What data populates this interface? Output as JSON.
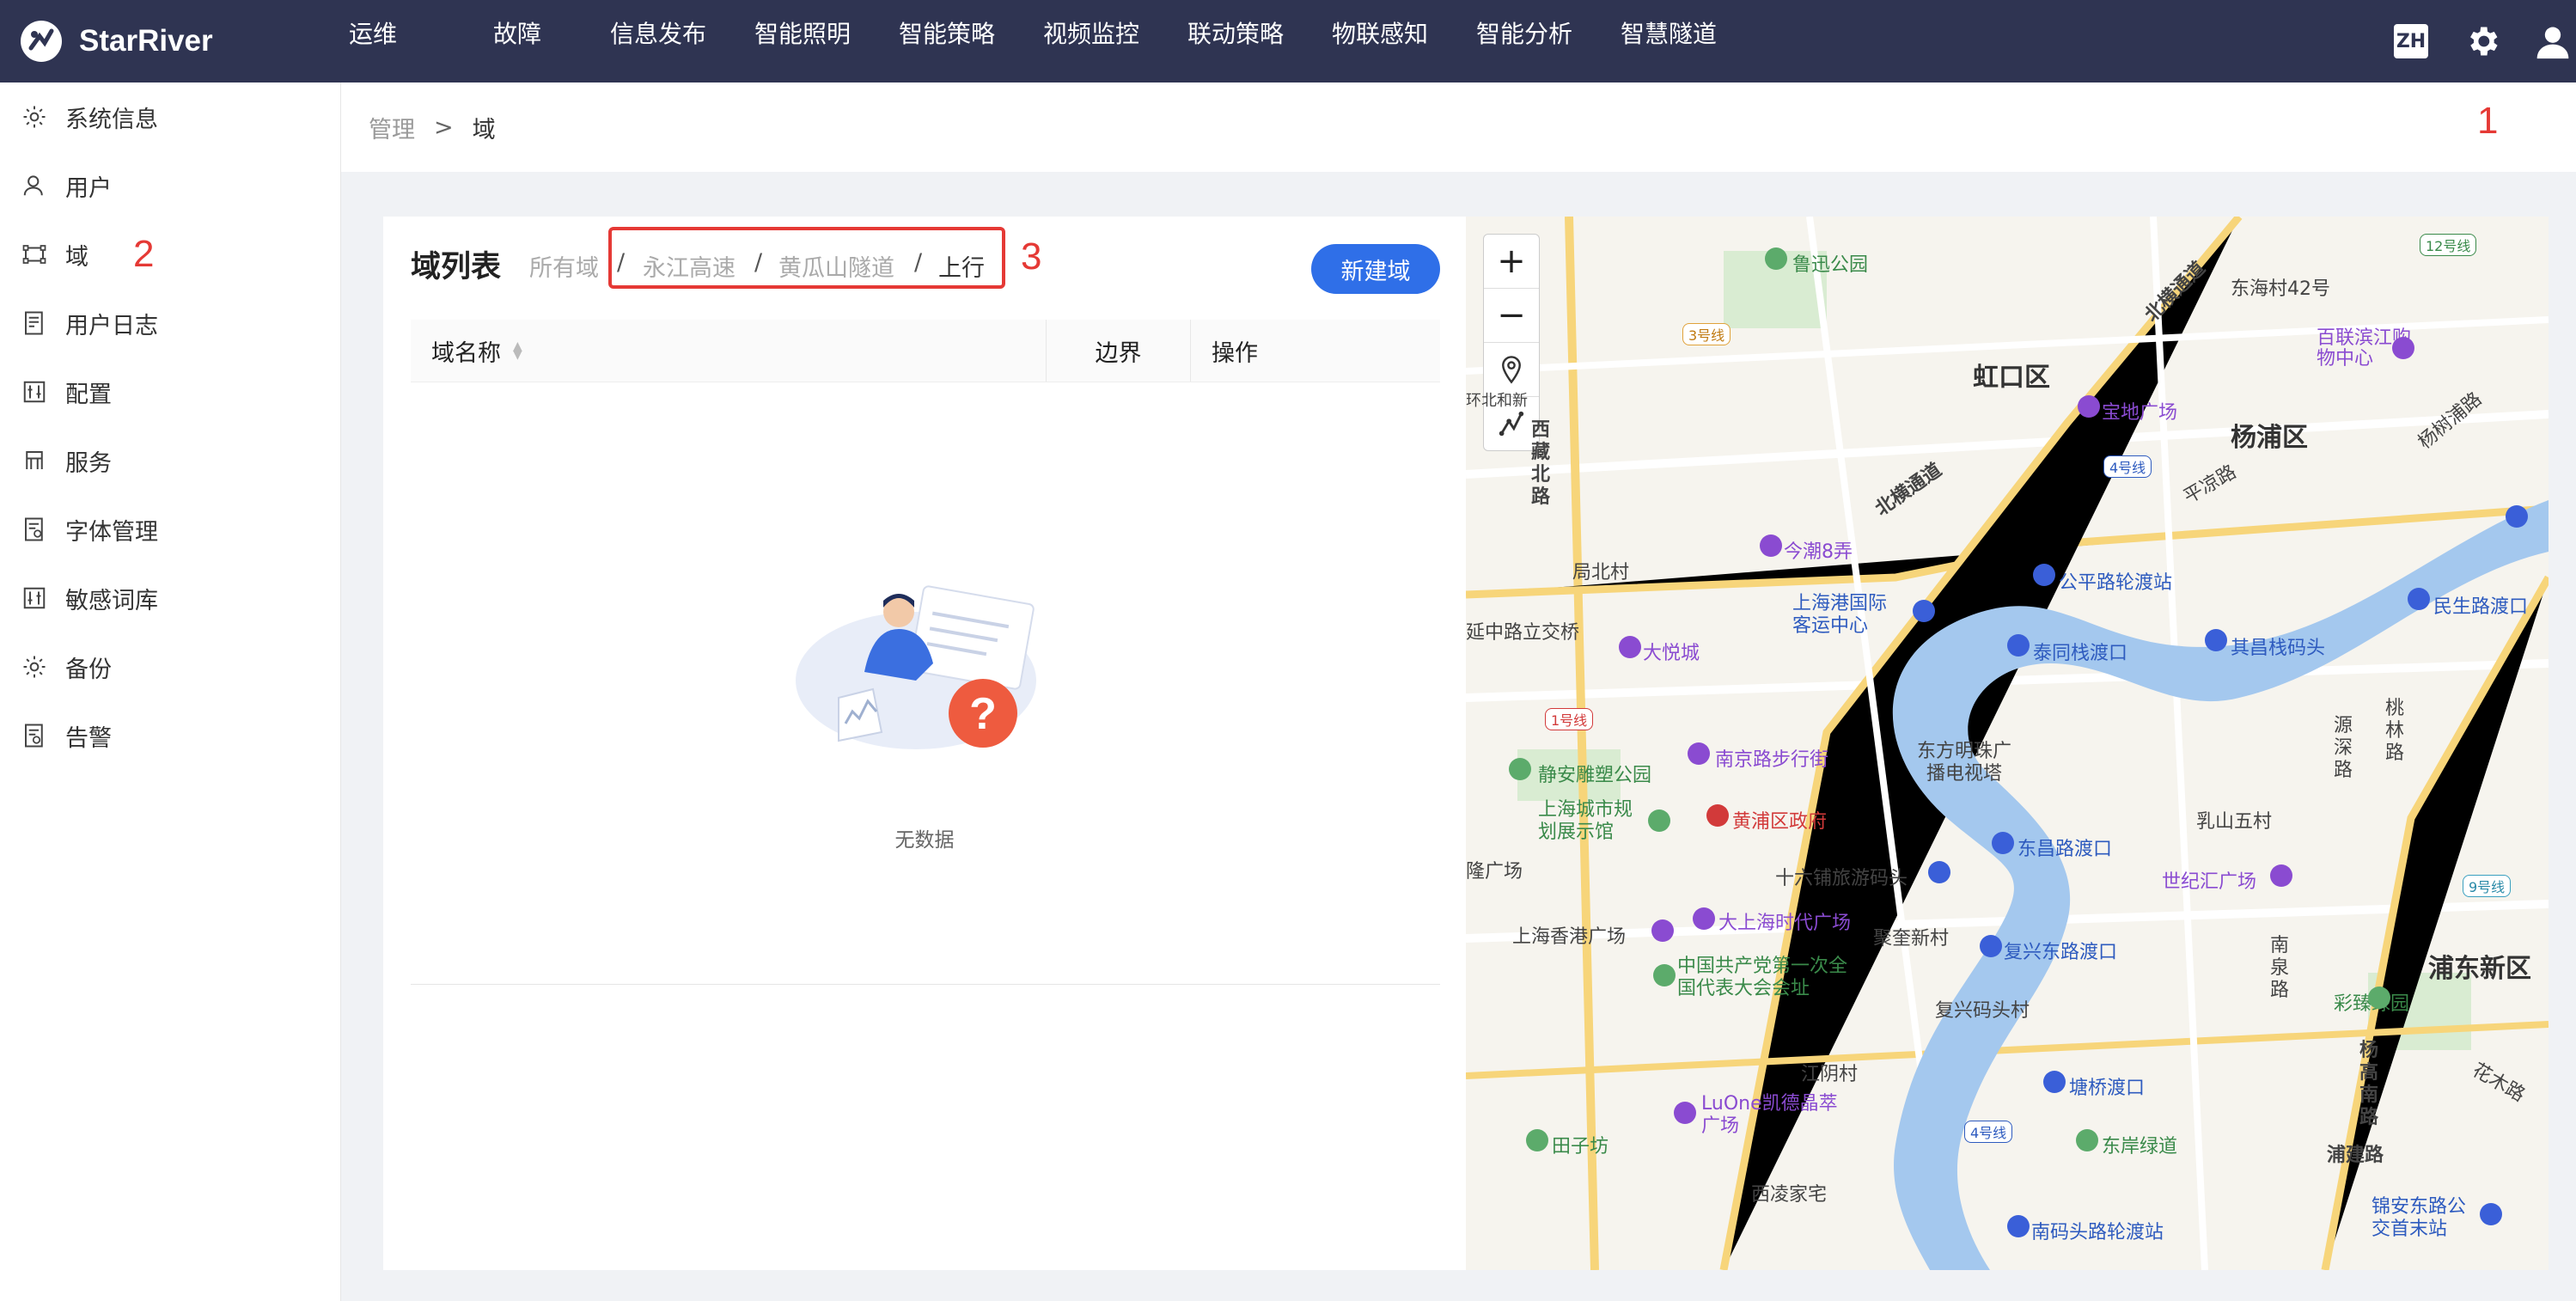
{
  "app": {
    "name": "StarRiver",
    "lang_badge": "ZH"
  },
  "nav": {
    "items": [
      "运维",
      "故障",
      "信息发布",
      "智能照明",
      "智能策略",
      "视频监控",
      "联动策略",
      "物联感知",
      "智能分析",
      "智慧隧道"
    ]
  },
  "sidebar": {
    "items": [
      {
        "label": "系统信息",
        "icon": "settings-icon"
      },
      {
        "label": "用户",
        "icon": "user-icon"
      },
      {
        "label": "域",
        "icon": "domain-icon"
      },
      {
        "label": "用户日志",
        "icon": "log-icon"
      },
      {
        "label": "配置",
        "icon": "config-icon"
      },
      {
        "label": "服务",
        "icon": "service-icon"
      },
      {
        "label": "字体管理",
        "icon": "font-icon"
      },
      {
        "label": "敏感词库",
        "icon": "sensitive-words-icon"
      },
      {
        "label": "备份",
        "icon": "backup-icon"
      },
      {
        "label": "告警",
        "icon": "alarm-icon"
      }
    ]
  },
  "annotations": {
    "one": "1",
    "two": "2",
    "three": "3"
  },
  "breadcrumb": {
    "parent": "管理",
    "current": "域"
  },
  "panel": {
    "title": "域列表",
    "domain_path": {
      "root": "所有域",
      "level1": "永江高速",
      "level2": "黄瓜山隧道",
      "level3": "上行",
      "sep": "/"
    },
    "new_button": "新建域",
    "columns": [
      "域名称",
      "边界",
      "操作"
    ],
    "empty_text": "无数据"
  },
  "map": {
    "controls": {
      "zoom_in": "+",
      "zoom_out": "−"
    },
    "labels": {
      "luxun": "鲁迅公园",
      "hongkou": "虹口区",
      "yangpu": "杨浦区",
      "pudong": "浦东新区",
      "baidi": "宝地广场",
      "dongyun": "东海村42号",
      "bailian": "百联滨江购物中心",
      "jinmo": "今潮8弄",
      "jubei": "局北村",
      "dayue": "大悦城",
      "port": "上海港国际客运中心",
      "gongping": "公平路轮渡站",
      "taitong": "泰同栈渡口",
      "qichang": "其昌栈码头",
      "minsheng": "民生路渡口",
      "nanjing": "南京路步行街",
      "oriental": "东方明珠广播电视塔",
      "jingan": "静安雕塑公园",
      "urban": "上海城市规划展示馆",
      "huangpu": "黄浦区政府",
      "shiliu": "十六铺旅游码头",
      "dongchang": "东昌路渡口",
      "rushan": "乳山五村",
      "shijihui": "世纪汇广场",
      "hkplaza": "上海香港广场",
      "dashanghai": "大上海时代广场",
      "juku": "聚奎新村",
      "fuxing": "复兴东路渡口",
      "cpc": "中国共产党第一次全国代表大会会址",
      "fuxingmatou": "复兴码头村",
      "caiqiu": "彩臻绿园",
      "jiangyin": "江阴村",
      "tangqiao": "塘桥渡口",
      "luone": "LuOne凯德晶萃广场",
      "tianzifang": "田子坊",
      "dongan": "东岸绿道",
      "xiling": "西凌家宅",
      "nanmatou": "南码头路轮渡站",
      "jinan": "锦安东路公交首末站",
      "pudonglu": "浦建路",
      "beiheng": "北横通道",
      "beiheng2": "北横通道",
      "xizang": "西藏北路",
      "pingliang": "平凉路",
      "yangshupu": "杨树浦路",
      "yangao": "杨高南路",
      "huamu": "花木路",
      "kangqiao": "源深路",
      "taolin": "桃林路",
      "nanquan": "南泉路",
      "yanzhong": "延中路立交桥",
      "jianglong": "隆广场",
      "line1": "1号线",
      "line3": "3号线",
      "line4": "4号线",
      "line4b": "4号线",
      "line9": "9号线",
      "line12": "12号线",
      "huanbei": "环北和新"
    }
  }
}
